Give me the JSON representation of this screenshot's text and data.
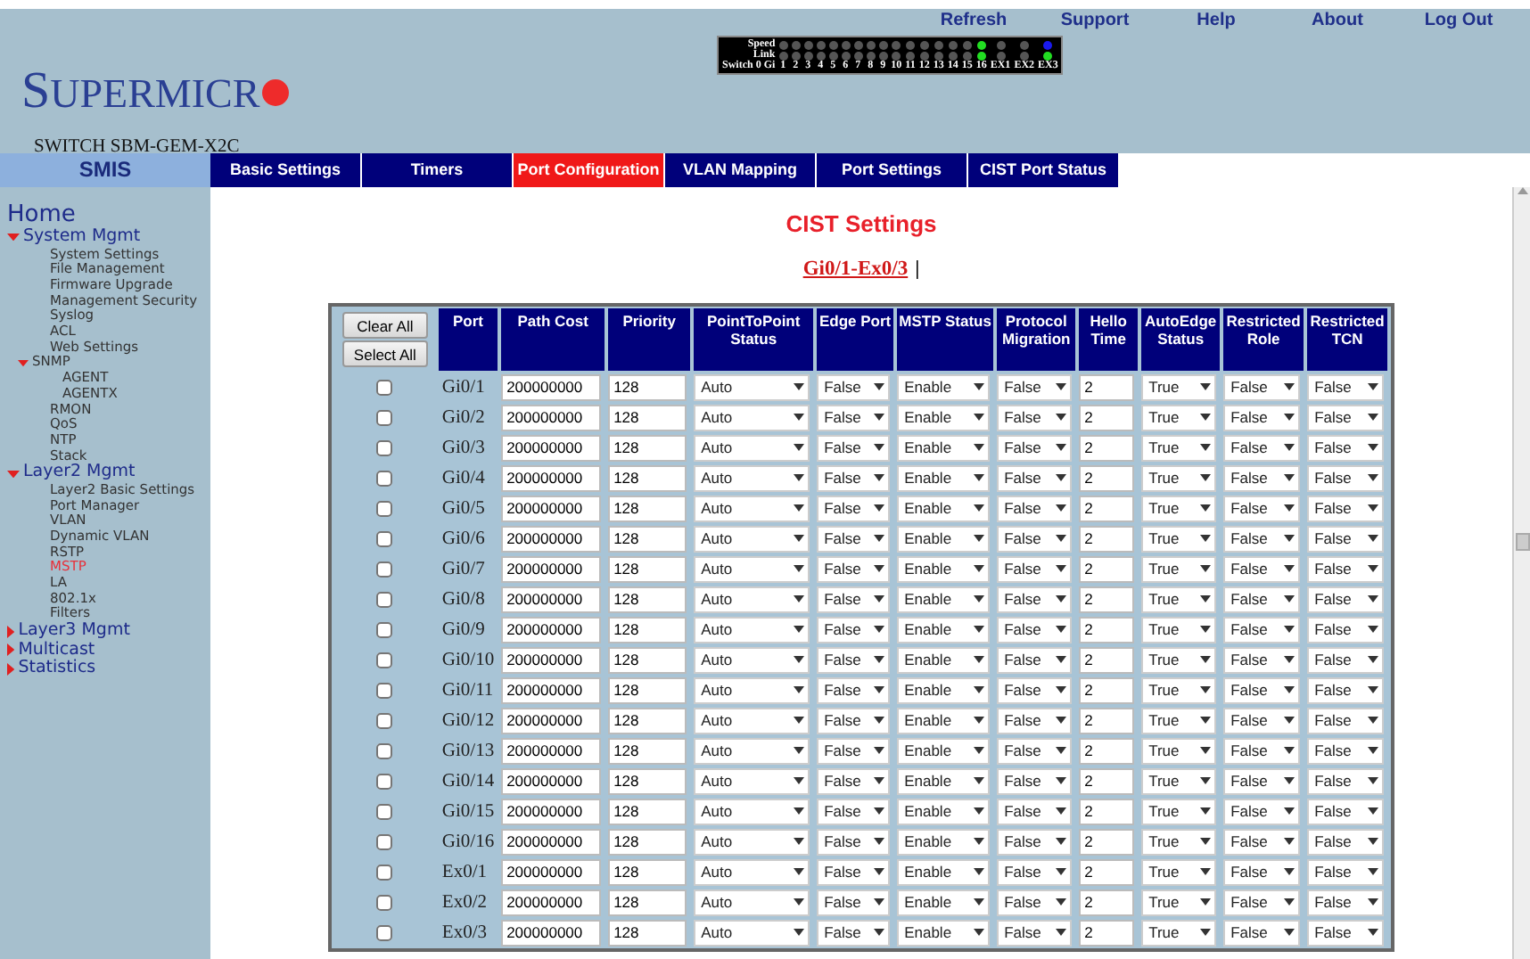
{
  "top_links": [
    "Refresh",
    "Support",
    "Help",
    "About",
    "Log Out"
  ],
  "logo": {
    "text": "SUPERMICR"
  },
  "switch_name": "SWITCH SBM-GEM-X2C",
  "led_panel": {
    "speed_label": "Speed",
    "link_label": "Link",
    "ports_label": "Switch 0 Gi",
    "ports": [
      {
        "label": "1",
        "speed": {
          "color": "#555555"
        },
        "link": {
          "color": "#555555"
        }
      },
      {
        "label": "2",
        "speed": {
          "color": "#555555"
        },
        "link": {
          "color": "#555555"
        }
      },
      {
        "label": "3",
        "speed": {
          "color": "#555555"
        },
        "link": {
          "color": "#555555"
        }
      },
      {
        "label": "4",
        "speed": {
          "color": "#555555"
        },
        "link": {
          "color": "#555555"
        }
      },
      {
        "label": "5",
        "speed": {
          "color": "#555555"
        },
        "link": {
          "color": "#555555"
        }
      },
      {
        "label": "6",
        "speed": {
          "color": "#555555"
        },
        "link": {
          "color": "#555555"
        }
      },
      {
        "label": "7",
        "speed": {
          "color": "#555555"
        },
        "link": {
          "color": "#555555"
        }
      },
      {
        "label": "8",
        "speed": {
          "color": "#555555"
        },
        "link": {
          "color": "#555555"
        }
      },
      {
        "label": "9",
        "speed": {
          "color": "#555555"
        },
        "link": {
          "color": "#555555"
        }
      },
      {
        "label": "10",
        "speed": {
          "color": "#555555"
        },
        "link": {
          "color": "#555555"
        }
      },
      {
        "label": "11",
        "speed": {
          "color": "#555555"
        },
        "link": {
          "color": "#555555"
        }
      },
      {
        "label": "12",
        "speed": {
          "color": "#555555"
        },
        "link": {
          "color": "#555555"
        }
      },
      {
        "label": "13",
        "speed": {
          "color": "#555555"
        },
        "link": {
          "color": "#555555"
        }
      },
      {
        "label": "14",
        "speed": {
          "color": "#555555"
        },
        "link": {
          "color": "#555555"
        }
      },
      {
        "label": "15",
        "speed": {
          "color": "#555555"
        },
        "link": {
          "color": "#555555"
        }
      },
      {
        "label": "16",
        "speed": {
          "color": "#22dd22"
        },
        "link": {
          "color": "#22dd22"
        }
      },
      {
        "label": "EX1",
        "speed": {
          "color": "#555555"
        },
        "link": {
          "color": "#555555"
        }
      },
      {
        "label": "EX2",
        "speed": {
          "color": "#555555"
        },
        "link": {
          "color": "#555555"
        }
      },
      {
        "label": "EX3",
        "speed": {
          "color": "#1a1aee"
        },
        "link": {
          "color": "#22dd22"
        }
      }
    ]
  },
  "nav": {
    "home_tab": "SMIS",
    "tabs": [
      {
        "label": "Basic Settings",
        "selected": false
      },
      {
        "label": "Timers",
        "selected": false
      },
      {
        "label": "Port Configuration",
        "selected": true
      },
      {
        "label": "VLAN Mapping",
        "selected": false
      },
      {
        "label": "Port Settings",
        "selected": false
      },
      {
        "label": "CIST Port Status",
        "selected": false
      }
    ]
  },
  "sidebar": {
    "items": [
      {
        "label": "Home",
        "selected": false
      },
      {
        "label": "System Mgmt",
        "expanded": true,
        "children": [
          {
            "label": "System Settings",
            "selected": false
          },
          {
            "label": "File Management",
            "selected": false
          },
          {
            "label": "Firmware Upgrade",
            "selected": false
          },
          {
            "label": "Management Security",
            "selected": false
          },
          {
            "label": "Syslog",
            "selected": false
          },
          {
            "label": "ACL",
            "selected": false
          },
          {
            "label": "Web Settings",
            "selected": false
          },
          {
            "label": "SNMP",
            "expanded": true,
            "children": [
              {
                "label": "AGENT",
                "selected": false
              },
              {
                "label": "AGENTX",
                "selected": false
              }
            ]
          },
          {
            "label": "RMON",
            "selected": false
          },
          {
            "label": "QoS",
            "selected": false
          },
          {
            "label": "NTP",
            "selected": false
          },
          {
            "label": "Stack",
            "selected": false
          }
        ]
      },
      {
        "label": "Layer2 Mgmt",
        "expanded": true,
        "children": [
          {
            "label": "Layer2 Basic Settings",
            "selected": false
          },
          {
            "label": "Port Manager",
            "selected": false
          },
          {
            "label": "VLAN",
            "selected": false
          },
          {
            "label": "Dynamic VLAN",
            "selected": false
          },
          {
            "label": "RSTP",
            "selected": false
          },
          {
            "label": "MSTP",
            "selected": true
          },
          {
            "label": "LA",
            "selected": false
          },
          {
            "label": "802.1x",
            "selected": false
          },
          {
            "label": "Filters",
            "selected": false
          }
        ]
      },
      {
        "label": "Layer3 Mgmt",
        "expanded": false
      },
      {
        "label": "Multicast",
        "expanded": false
      },
      {
        "label": "Statistics",
        "expanded": false
      }
    ]
  },
  "content": {
    "title": "CIST Settings",
    "range_link": "Gi0/1-Ex0/3",
    "range_separator": "|",
    "table": {
      "columns": [
        {
          "kind": "buttons",
          "buttons": [
            "Clear All",
            "Select All"
          ]
        },
        {
          "kind": "label",
          "label": "Port"
        },
        {
          "kind": "label",
          "label": "Path Cost"
        },
        {
          "kind": "label",
          "label": "Priority"
        },
        {
          "kind": "label",
          "label": "PointToPoint Status"
        },
        {
          "kind": "label",
          "label": "Edge Port"
        },
        {
          "kind": "label",
          "label": "MSTP Status"
        },
        {
          "kind": "label",
          "label": "Protocol Migration"
        },
        {
          "kind": "label",
          "label": "Hello Time"
        },
        {
          "kind": "label",
          "label": "AutoEdge Status"
        },
        {
          "kind": "label",
          "label": "Restricted Role"
        },
        {
          "kind": "label",
          "label": "Restricted TCN"
        }
      ],
      "rows": [
        {
          "cells": [
            {
              "kind": "checkbox",
              "checked": false
            },
            {
              "kind": "text",
              "value": "Gi0/1"
            },
            {
              "kind": "input",
              "value": "200000000"
            },
            {
              "kind": "input",
              "value": "128"
            },
            {
              "kind": "select",
              "value": "Auto"
            },
            {
              "kind": "select",
              "value": "False"
            },
            {
              "kind": "select",
              "value": "Enable"
            },
            {
              "kind": "select",
              "value": "False"
            },
            {
              "kind": "input",
              "value": "2"
            },
            {
              "kind": "select",
              "value": "True"
            },
            {
              "kind": "select",
              "value": "False"
            },
            {
              "kind": "select",
              "value": "False"
            }
          ]
        },
        {
          "cells": [
            {
              "kind": "checkbox",
              "checked": false
            },
            {
              "kind": "text",
              "value": "Gi0/2"
            },
            {
              "kind": "input",
              "value": "200000000"
            },
            {
              "kind": "input",
              "value": "128"
            },
            {
              "kind": "select",
              "value": "Auto"
            },
            {
              "kind": "select",
              "value": "False"
            },
            {
              "kind": "select",
              "value": "Enable"
            },
            {
              "kind": "select",
              "value": "False"
            },
            {
              "kind": "input",
              "value": "2"
            },
            {
              "kind": "select",
              "value": "True"
            },
            {
              "kind": "select",
              "value": "False"
            },
            {
              "kind": "select",
              "value": "False"
            }
          ]
        },
        {
          "cells": [
            {
              "kind": "checkbox",
              "checked": false
            },
            {
              "kind": "text",
              "value": "Gi0/3"
            },
            {
              "kind": "input",
              "value": "200000000"
            },
            {
              "kind": "input",
              "value": "128"
            },
            {
              "kind": "select",
              "value": "Auto"
            },
            {
              "kind": "select",
              "value": "False"
            },
            {
              "kind": "select",
              "value": "Enable"
            },
            {
              "kind": "select",
              "value": "False"
            },
            {
              "kind": "input",
              "value": "2"
            },
            {
              "kind": "select",
              "value": "True"
            },
            {
              "kind": "select",
              "value": "False"
            },
            {
              "kind": "select",
              "value": "False"
            }
          ]
        },
        {
          "cells": [
            {
              "kind": "checkbox",
              "checked": false
            },
            {
              "kind": "text",
              "value": "Gi0/4"
            },
            {
              "kind": "input",
              "value": "200000000"
            },
            {
              "kind": "input",
              "value": "128"
            },
            {
              "kind": "select",
              "value": "Auto"
            },
            {
              "kind": "select",
              "value": "False"
            },
            {
              "kind": "select",
              "value": "Enable"
            },
            {
              "kind": "select",
              "value": "False"
            },
            {
              "kind": "input",
              "value": "2"
            },
            {
              "kind": "select",
              "value": "True"
            },
            {
              "kind": "select",
              "value": "False"
            },
            {
              "kind": "select",
              "value": "False"
            }
          ]
        },
        {
          "cells": [
            {
              "kind": "checkbox",
              "checked": false
            },
            {
              "kind": "text",
              "value": "Gi0/5"
            },
            {
              "kind": "input",
              "value": "200000000"
            },
            {
              "kind": "input",
              "value": "128"
            },
            {
              "kind": "select",
              "value": "Auto"
            },
            {
              "kind": "select",
              "value": "False"
            },
            {
              "kind": "select",
              "value": "Enable"
            },
            {
              "kind": "select",
              "value": "False"
            },
            {
              "kind": "input",
              "value": "2"
            },
            {
              "kind": "select",
              "value": "True"
            },
            {
              "kind": "select",
              "value": "False"
            },
            {
              "kind": "select",
              "value": "False"
            }
          ]
        },
        {
          "cells": [
            {
              "kind": "checkbox",
              "checked": false
            },
            {
              "kind": "text",
              "value": "Gi0/6"
            },
            {
              "kind": "input",
              "value": "200000000"
            },
            {
              "kind": "input",
              "value": "128"
            },
            {
              "kind": "select",
              "value": "Auto"
            },
            {
              "kind": "select",
              "value": "False"
            },
            {
              "kind": "select",
              "value": "Enable"
            },
            {
              "kind": "select",
              "value": "False"
            },
            {
              "kind": "input",
              "value": "2"
            },
            {
              "kind": "select",
              "value": "True"
            },
            {
              "kind": "select",
              "value": "False"
            },
            {
              "kind": "select",
              "value": "False"
            }
          ]
        },
        {
          "cells": [
            {
              "kind": "checkbox",
              "checked": false
            },
            {
              "kind": "text",
              "value": "Gi0/7"
            },
            {
              "kind": "input",
              "value": "200000000"
            },
            {
              "kind": "input",
              "value": "128"
            },
            {
              "kind": "select",
              "value": "Auto"
            },
            {
              "kind": "select",
              "value": "False"
            },
            {
              "kind": "select",
              "value": "Enable"
            },
            {
              "kind": "select",
              "value": "False"
            },
            {
              "kind": "input",
              "value": "2"
            },
            {
              "kind": "select",
              "value": "True"
            },
            {
              "kind": "select",
              "value": "False"
            },
            {
              "kind": "select",
              "value": "False"
            }
          ]
        },
        {
          "cells": [
            {
              "kind": "checkbox",
              "checked": false
            },
            {
              "kind": "text",
              "value": "Gi0/8"
            },
            {
              "kind": "input",
              "value": "200000000"
            },
            {
              "kind": "input",
              "value": "128"
            },
            {
              "kind": "select",
              "value": "Auto"
            },
            {
              "kind": "select",
              "value": "False"
            },
            {
              "kind": "select",
              "value": "Enable"
            },
            {
              "kind": "select",
              "value": "False"
            },
            {
              "kind": "input",
              "value": "2"
            },
            {
              "kind": "select",
              "value": "True"
            },
            {
              "kind": "select",
              "value": "False"
            },
            {
              "kind": "select",
              "value": "False"
            }
          ]
        },
        {
          "cells": [
            {
              "kind": "checkbox",
              "checked": false
            },
            {
              "kind": "text",
              "value": "Gi0/9"
            },
            {
              "kind": "input",
              "value": "200000000"
            },
            {
              "kind": "input",
              "value": "128"
            },
            {
              "kind": "select",
              "value": "Auto"
            },
            {
              "kind": "select",
              "value": "False"
            },
            {
              "kind": "select",
              "value": "Enable"
            },
            {
              "kind": "select",
              "value": "False"
            },
            {
              "kind": "input",
              "value": "2"
            },
            {
              "kind": "select",
              "value": "True"
            },
            {
              "kind": "select",
              "value": "False"
            },
            {
              "kind": "select",
              "value": "False"
            }
          ]
        },
        {
          "cells": [
            {
              "kind": "checkbox",
              "checked": false
            },
            {
              "kind": "text",
              "value": "Gi0/10"
            },
            {
              "kind": "input",
              "value": "200000000"
            },
            {
              "kind": "input",
              "value": "128"
            },
            {
              "kind": "select",
              "value": "Auto"
            },
            {
              "kind": "select",
              "value": "False"
            },
            {
              "kind": "select",
              "value": "Enable"
            },
            {
              "kind": "select",
              "value": "False"
            },
            {
              "kind": "input",
              "value": "2"
            },
            {
              "kind": "select",
              "value": "True"
            },
            {
              "kind": "select",
              "value": "False"
            },
            {
              "kind": "select",
              "value": "False"
            }
          ]
        },
        {
          "cells": [
            {
              "kind": "checkbox",
              "checked": false
            },
            {
              "kind": "text",
              "value": "Gi0/11"
            },
            {
              "kind": "input",
              "value": "200000000"
            },
            {
              "kind": "input",
              "value": "128"
            },
            {
              "kind": "select",
              "value": "Auto"
            },
            {
              "kind": "select",
              "value": "False"
            },
            {
              "kind": "select",
              "value": "Enable"
            },
            {
              "kind": "select",
              "value": "False"
            },
            {
              "kind": "input",
              "value": "2"
            },
            {
              "kind": "select",
              "value": "True"
            },
            {
              "kind": "select",
              "value": "False"
            },
            {
              "kind": "select",
              "value": "False"
            }
          ]
        },
        {
          "cells": [
            {
              "kind": "checkbox",
              "checked": false
            },
            {
              "kind": "text",
              "value": "Gi0/12"
            },
            {
              "kind": "input",
              "value": "200000000"
            },
            {
              "kind": "input",
              "value": "128"
            },
            {
              "kind": "select",
              "value": "Auto"
            },
            {
              "kind": "select",
              "value": "False"
            },
            {
              "kind": "select",
              "value": "Enable"
            },
            {
              "kind": "select",
              "value": "False"
            },
            {
              "kind": "input",
              "value": "2"
            },
            {
              "kind": "select",
              "value": "True"
            },
            {
              "kind": "select",
              "value": "False"
            },
            {
              "kind": "select",
              "value": "False"
            }
          ]
        },
        {
          "cells": [
            {
              "kind": "checkbox",
              "checked": false
            },
            {
              "kind": "text",
              "value": "Gi0/13"
            },
            {
              "kind": "input",
              "value": "200000000"
            },
            {
              "kind": "input",
              "value": "128"
            },
            {
              "kind": "select",
              "value": "Auto"
            },
            {
              "kind": "select",
              "value": "False"
            },
            {
              "kind": "select",
              "value": "Enable"
            },
            {
              "kind": "select",
              "value": "False"
            },
            {
              "kind": "input",
              "value": "2"
            },
            {
              "kind": "select",
              "value": "True"
            },
            {
              "kind": "select",
              "value": "False"
            },
            {
              "kind": "select",
              "value": "False"
            }
          ]
        },
        {
          "cells": [
            {
              "kind": "checkbox",
              "checked": false
            },
            {
              "kind": "text",
              "value": "Gi0/14"
            },
            {
              "kind": "input",
              "value": "200000000"
            },
            {
              "kind": "input",
              "value": "128"
            },
            {
              "kind": "select",
              "value": "Auto"
            },
            {
              "kind": "select",
              "value": "False"
            },
            {
              "kind": "select",
              "value": "Enable"
            },
            {
              "kind": "select",
              "value": "False"
            },
            {
              "kind": "input",
              "value": "2"
            },
            {
              "kind": "select",
              "value": "True"
            },
            {
              "kind": "select",
              "value": "False"
            },
            {
              "kind": "select",
              "value": "False"
            }
          ]
        },
        {
          "cells": [
            {
              "kind": "checkbox",
              "checked": false
            },
            {
              "kind": "text",
              "value": "Gi0/15"
            },
            {
              "kind": "input",
              "value": "200000000"
            },
            {
              "kind": "input",
              "value": "128"
            },
            {
              "kind": "select",
              "value": "Auto"
            },
            {
              "kind": "select",
              "value": "False"
            },
            {
              "kind": "select",
              "value": "Enable"
            },
            {
              "kind": "select",
              "value": "False"
            },
            {
              "kind": "input",
              "value": "2"
            },
            {
              "kind": "select",
              "value": "True"
            },
            {
              "kind": "select",
              "value": "False"
            },
            {
              "kind": "select",
              "value": "False"
            }
          ]
        },
        {
          "cells": [
            {
              "kind": "checkbox",
              "checked": false
            },
            {
              "kind": "text",
              "value": "Gi0/16"
            },
            {
              "kind": "input",
              "value": "200000000"
            },
            {
              "kind": "input",
              "value": "128"
            },
            {
              "kind": "select",
              "value": "Auto"
            },
            {
              "kind": "select",
              "value": "False"
            },
            {
              "kind": "select",
              "value": "Enable"
            },
            {
              "kind": "select",
              "value": "False"
            },
            {
              "kind": "input",
              "value": "2"
            },
            {
              "kind": "select",
              "value": "True"
            },
            {
              "kind": "select",
              "value": "False"
            },
            {
              "kind": "select",
              "value": "False"
            }
          ]
        },
        {
          "cells": [
            {
              "kind": "checkbox",
              "checked": false
            },
            {
              "kind": "text",
              "value": "Ex0/1"
            },
            {
              "kind": "input",
              "value": "200000000"
            },
            {
              "kind": "input",
              "value": "128"
            },
            {
              "kind": "select",
              "value": "Auto"
            },
            {
              "kind": "select",
              "value": "False"
            },
            {
              "kind": "select",
              "value": "Enable"
            },
            {
              "kind": "select",
              "value": "False"
            },
            {
              "kind": "input",
              "value": "2"
            },
            {
              "kind": "select",
              "value": "True"
            },
            {
              "kind": "select",
              "value": "False"
            },
            {
              "kind": "select",
              "value": "False"
            }
          ]
        },
        {
          "cells": [
            {
              "kind": "checkbox",
              "checked": false
            },
            {
              "kind": "text",
              "value": "Ex0/2"
            },
            {
              "kind": "input",
              "value": "200000000"
            },
            {
              "kind": "input",
              "value": "128"
            },
            {
              "kind": "select",
              "value": "Auto"
            },
            {
              "kind": "select",
              "value": "False"
            },
            {
              "kind": "select",
              "value": "Enable"
            },
            {
              "kind": "select",
              "value": "False"
            },
            {
              "kind": "input",
              "value": "2"
            },
            {
              "kind": "select",
              "value": "True"
            },
            {
              "kind": "select",
              "value": "False"
            },
            {
              "kind": "select",
              "value": "False"
            }
          ]
        },
        {
          "cells": [
            {
              "kind": "checkbox",
              "checked": false
            },
            {
              "kind": "text",
              "value": "Ex0/3"
            },
            {
              "kind": "input",
              "value": "200000000"
            },
            {
              "kind": "input",
              "value": "128"
            },
            {
              "kind": "select",
              "value": "Auto"
            },
            {
              "kind": "select",
              "value": "False"
            },
            {
              "kind": "select",
              "value": "Enable"
            },
            {
              "kind": "select",
              "value": "False"
            },
            {
              "kind": "input",
              "value": "2"
            },
            {
              "kind": "select",
              "value": "True"
            },
            {
              "kind": "select",
              "value": "False"
            },
            {
              "kind": "select",
              "value": "False"
            }
          ]
        }
      ]
    }
  }
}
